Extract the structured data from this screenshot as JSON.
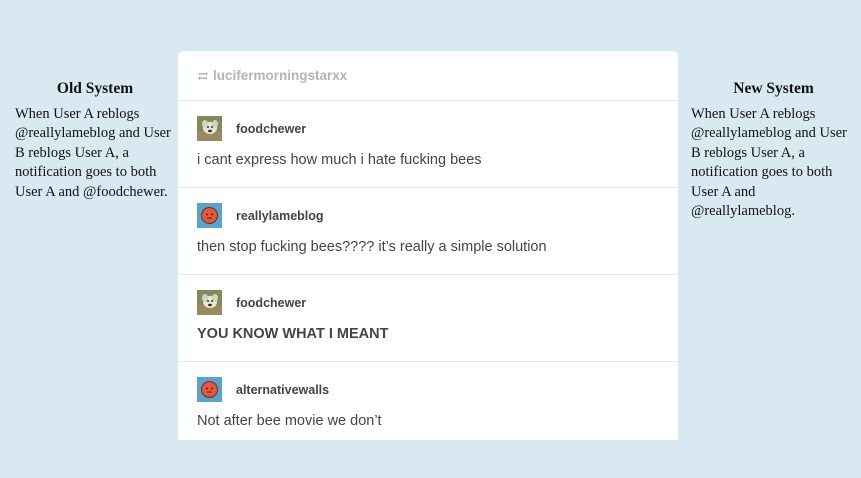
{
  "left_panel": {
    "title": "Old System",
    "text": "When User A reblogs @reallylameblog and User B reblogs User A, a notification goes to both User A and @foodchewer."
  },
  "right_panel": {
    "title": "New System",
    "text": "When User A reblogs @reallylameblog and User B reblogs User A, a notification goes to both User A and @reallylameblog."
  },
  "card": {
    "header_icon": "reblog-icon",
    "header_user": "lucifermorningstarxx",
    "posts": [
      {
        "avatar": "dog-avatar",
        "username": "foodchewer",
        "text": "i cant express how much i hate fucking bees"
      },
      {
        "avatar": "orange-face-avatar",
        "username": "reallylameblog",
        "text": "then stop fucking bees???? it’s really a simple solution"
      },
      {
        "avatar": "dog-avatar",
        "username": "foodchewer",
        "text": "YOU KNOW WHAT I MEANT"
      },
      {
        "avatar": "orange-face-avatar",
        "username": "alternativewalls",
        "text": "Not after bee movie we don’t"
      }
    ]
  },
  "colors": {
    "background": "#d9e9f2",
    "card": "#ffffff",
    "username": "#444444",
    "header_user": "#b4b4b4"
  }
}
